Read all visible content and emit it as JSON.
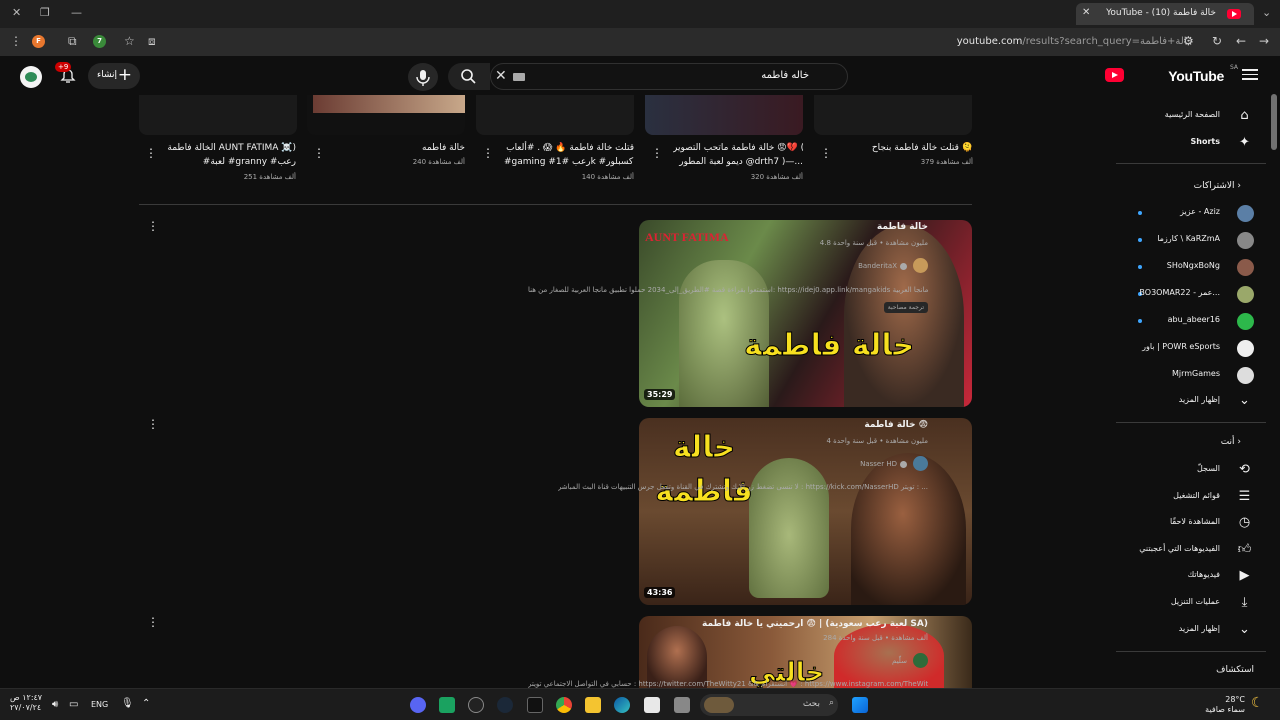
{
  "browser": {
    "tab_title": "YouTube - (10) خالة فاطمة",
    "url_host": "youtube.com",
    "url_path": "/results?search_query=خالة+فاطمة"
  },
  "topbar": {
    "logo_text": "YouTube",
    "logo_region": "SA",
    "search_value": "خاله فاطمه",
    "create_label": "إنشاء",
    "notifications_badge": "+9"
  },
  "sidebar": {
    "nav": [
      {
        "label": "الصفحة الرئيسية",
        "icon": "home-icon"
      },
      {
        "label": "Shorts",
        "icon": "shorts-icon"
      }
    ],
    "subscriptions_header": "الاشتراكات",
    "subscriptions": [
      {
        "label": "عزيز - Aziz",
        "color": "#5b7fa6"
      },
      {
        "label": "كارزما \\ KaRZmA",
        "color": "#888888"
      },
      {
        "label": "SHoNgxBoNg",
        "color": "#8a5a4a"
      },
      {
        "label": "BO3OMAR22 - عمر...",
        "color": "#9aa86a"
      },
      {
        "label": "abu_abeer16",
        "color": "#2db84b"
      },
      {
        "label": "باور | POWR eSports",
        "color": "#eeeeee"
      },
      {
        "label": "MjrmGames",
        "color": "#dddddd"
      }
    ],
    "subs_more": "إظهار المزيد",
    "you_header": "أنت",
    "you_items": [
      {
        "label": "السجلّ",
        "icon": "history-icon"
      },
      {
        "label": "قوائم التشغيل",
        "icon": "playlists-icon"
      },
      {
        "label": "المشاهدة لاحقًا",
        "icon": "watch-later-icon"
      },
      {
        "label": "الفيديوهات التي أعجبتني",
        "icon": "like-icon"
      },
      {
        "label": "فيديوهاتك",
        "icon": "your-videos-icon"
      },
      {
        "label": "عمليات التنزيل",
        "icon": "download-icon"
      }
    ],
    "you_more": "إظهار المزيد",
    "explore_header": "استكشاف"
  },
  "shorts": [
    {
      "title": "قتلت خالة فاطمة بنجاح 🫠",
      "title2": "",
      "views": "379 ألف مشاهدة"
    },
    {
      "title": "خالة فاطمة ماتحب التصوير 😡💔 (",
      "title2": "ديمو لعبة المطور @drth7 )—...",
      "views": "320 ألف مشاهدة"
    },
    {
      "title": "قتلت خالة فاطمة 🔥 😱 . #ألعاب",
      "title2": "#gaming #رعب #1k #اكسبلور...",
      "views": "140 ألف مشاهدة"
    },
    {
      "title": "خالة فاطمه",
      "title2": "",
      "views": "240 ألف مشاهدة"
    },
    {
      "title": "الخالة فاطمة AUNT FATIMA ☠️)",
      "title2": "#لعبة #granny #رعب",
      "views": "251 ألف مشاهدة"
    }
  ],
  "videos": [
    {
      "title": "خالة فاطمة",
      "meta": "4.8 مليون مشاهدة • قبل سنة واحدة",
      "channel": "BanderitaX",
      "channel_color": "#c79a5a",
      "desc": "استمتعوا بقراءة قصة #الطريق_إلى_2034 حملوا تطبيق مانجا العربية للصغار من هنا: https://idej0.app.link/mangakids أو مانجا العربية ...",
      "chip": "ترجمة مصاحبة",
      "duration": "35:29",
      "thumb_text": "خالة فاطمة",
      "thumb_badge": "AUNT FATIMA"
    },
    {
      "title": "خالة فاطمة 😨",
      "meta": "4 مليون مشاهدة • قبل سنة واحدة",
      "channel": "Nasser HD",
      "channel_color": "#4a7a9a",
      "desc": "لا تنسى تضغط زر الإيك وتشترك في القناة وتفعل جرس التنبيهات قناة البث المباشر : https://kick.com/NasserHD تويتر : ...",
      "chip": "",
      "duration": "43:36",
      "thumb_text": "خالة فاطمة",
      "thumb_badge": ""
    },
    {
      "title": "ارحميني يا خالة فاطمة 😨 | (لعبة رعب سعودية SA)",
      "meta": "284 ألف مشاهدة • قبل سنة واحدة",
      "channel": "سلّيم",
      "channel_color": "#2e6b3a",
      "desc": "حسابي في التواصل الاجتماعي تويتر : https://twitter.com/TheWitty21 && انستقرام 💗 : https://www.instagram.com/TheWitty21 ...",
      "chip": "",
      "duration": "",
      "thumb_text": "خالتي",
      "thumb_badge": ""
    }
  ],
  "taskbar": {
    "search_label": "بحث",
    "lang": "ENG",
    "time": "١٢:٤٧ ص",
    "date": "٢٧/٠٧/٢٤",
    "weather_temp": "28°C",
    "weather_desc": "سماء صافية",
    "icons": [
      "discord-icon",
      "app-icon",
      "g-icon",
      "steam-icon",
      "capcut-icon",
      "chrome-icon",
      "folder-icon",
      "edge-icon",
      "store-icon",
      "terminal-icon",
      "windows-start-icon"
    ]
  }
}
